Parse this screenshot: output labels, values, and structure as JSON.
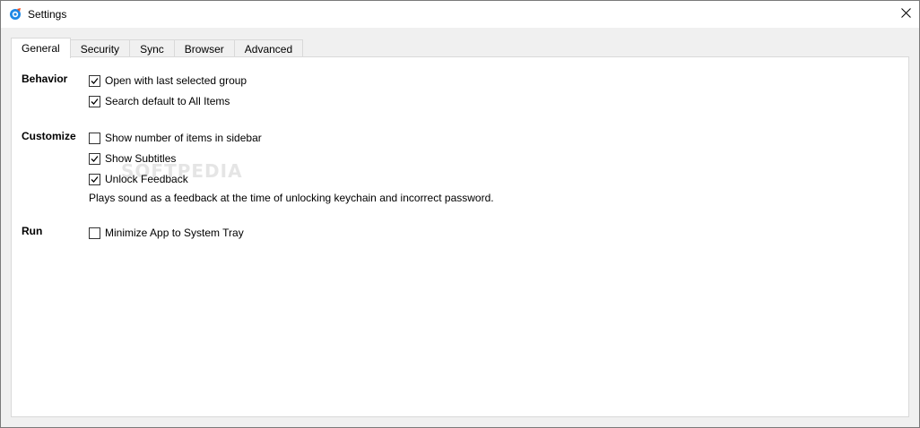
{
  "window": {
    "title": "Settings",
    "app_icon": "app-logo-icon",
    "close_icon": "close-icon"
  },
  "tabs": [
    {
      "label": "General",
      "active": true
    },
    {
      "label": "Security",
      "active": false
    },
    {
      "label": "Sync",
      "active": false
    },
    {
      "label": "Browser",
      "active": false
    },
    {
      "label": "Advanced",
      "active": false
    }
  ],
  "sections": {
    "behavior": {
      "label": "Behavior",
      "options": [
        {
          "label": "Open with last selected group",
          "checked": true
        },
        {
          "label": "Search default to All Items",
          "checked": true
        }
      ]
    },
    "customize": {
      "label": "Customize",
      "options": [
        {
          "label": "Show number of items in sidebar",
          "checked": false
        },
        {
          "label": "Show Subtitles",
          "checked": true
        },
        {
          "label": "Unlock Feedback",
          "checked": true
        }
      ],
      "hint": "Plays sound as a feedback at the time of unlocking keychain and incorrect password."
    },
    "run": {
      "label": "Run",
      "options": [
        {
          "label": "Minimize App to System Tray",
          "checked": false
        }
      ]
    }
  },
  "watermark": "SOFTPEDIA"
}
